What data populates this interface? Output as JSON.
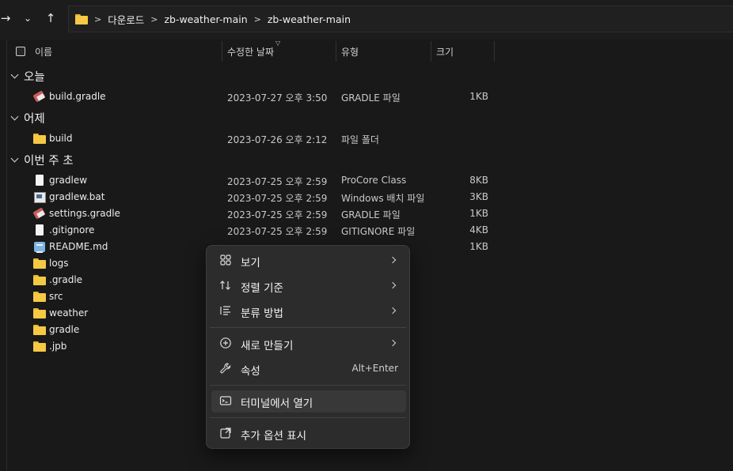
{
  "breadcrumb": [
    "다운로드",
    "zb-weather-main",
    "zb-weather-main"
  ],
  "columns": {
    "name": "이름",
    "modified": "수정한 날짜",
    "type": "유형",
    "size": "크기"
  },
  "groups": [
    {
      "label": "오늘",
      "items": [
        {
          "name": "build.gradle",
          "icon": "gradle-file-icon",
          "date": "2023-07-27 오후 3:50",
          "type": "GRADLE 파일",
          "size": "1KB"
        }
      ]
    },
    {
      "label": "어제",
      "items": [
        {
          "name": "build",
          "icon": "folder-icon",
          "date": "2023-07-26 오후 2:12",
          "type": "파일 폴더",
          "size": ""
        }
      ]
    },
    {
      "label": "이번 주 초",
      "items": [
        {
          "name": "gradlew",
          "icon": "file-icon",
          "date": "2023-07-25 오후 2:59",
          "type": "ProCore Class",
          "size": "8KB"
        },
        {
          "name": "gradlew.bat",
          "icon": "batch-file-icon",
          "date": "2023-07-25 오후 2:59",
          "type": "Windows 배치 파일",
          "size": "3KB"
        },
        {
          "name": "settings.gradle",
          "icon": "gradle-file-icon",
          "date": "2023-07-25 오후 2:59",
          "type": "GRADLE 파일",
          "size": "1KB"
        },
        {
          "name": ".gitignore",
          "icon": "file-icon",
          "date": "2023-07-25 오후 2:59",
          "type": "GITIGNORE 파일",
          "size": "4KB"
        },
        {
          "name": "README.md",
          "icon": "markdown-file-icon",
          "date": "",
          "type": "",
          "size": "1KB"
        },
        {
          "name": "logs",
          "icon": "folder-icon",
          "date": "",
          "type": "",
          "size": ""
        },
        {
          "name": ".gradle",
          "icon": "folder-icon",
          "date": "",
          "type": "",
          "size": ""
        },
        {
          "name": "src",
          "icon": "folder-icon",
          "date": "",
          "type": "",
          "size": ""
        },
        {
          "name": "weather",
          "icon": "folder-icon",
          "date": "",
          "type": "",
          "size": ""
        },
        {
          "name": "gradle",
          "icon": "folder-icon",
          "date": "",
          "type": "",
          "size": ""
        },
        {
          "name": ".jpb",
          "icon": "folder-icon",
          "date": "",
          "type": "",
          "size": ""
        }
      ]
    }
  ],
  "context_menu": {
    "items": [
      {
        "label": "보기",
        "icon": "grid-view-icon",
        "submenu": true
      },
      {
        "label": "정렬 기준",
        "icon": "sort-icon",
        "submenu": true
      },
      {
        "label": "분류 방법",
        "icon": "group-by-icon",
        "submenu": true
      },
      {
        "label": "새로 만들기",
        "icon": "new-plus-icon",
        "submenu": true
      },
      {
        "label": "속성",
        "icon": "wrench-icon",
        "shortcut": "Alt+Enter"
      },
      {
        "label": "터미널에서 열기",
        "icon": "terminal-icon",
        "highlighted": true
      },
      {
        "label": "추가 옵션 표시",
        "icon": "more-options-icon"
      }
    ]
  },
  "colors": {
    "background": "#191919",
    "menu_background": "#2c2c2c",
    "folder": "#f6c945"
  }
}
